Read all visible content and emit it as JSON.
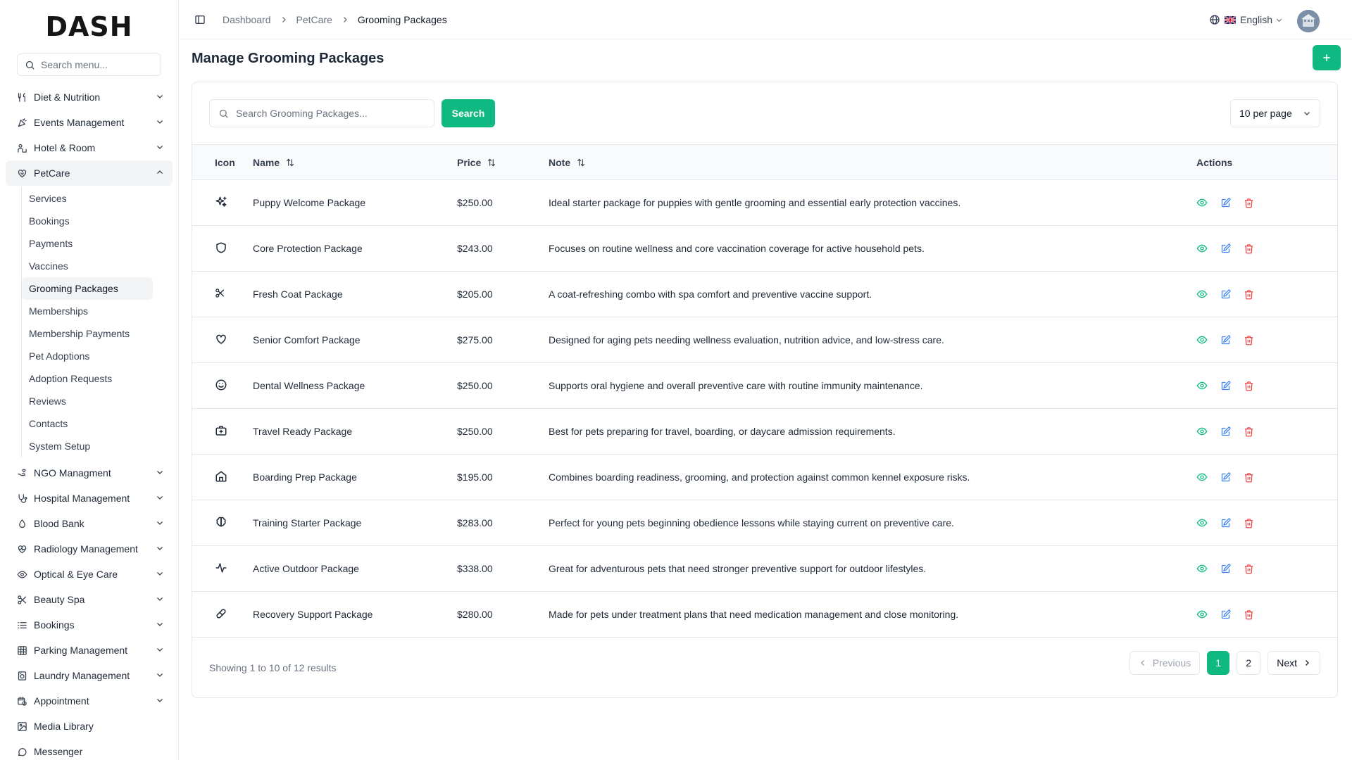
{
  "app": {
    "logo": "DASH",
    "accent": "#10b981"
  },
  "sidebar": {
    "search_placeholder": "Search menu...",
    "items": [
      {
        "label": "Diet & Nutrition",
        "icon": "utensils-icon"
      },
      {
        "label": "Events Management",
        "icon": "party-icon"
      },
      {
        "label": "Hotel & Room",
        "icon": "hotel-icon"
      },
      {
        "label": "PetCare",
        "icon": "paw-heart-icon",
        "open": true
      },
      {
        "label": "NGO Managment",
        "icon": "hand-heart-icon"
      },
      {
        "label": "Hospital Management",
        "icon": "stethoscope-icon"
      },
      {
        "label": "Blood Bank",
        "icon": "drop-icon"
      },
      {
        "label": "Radiology Management",
        "icon": "heart-pulse-icon"
      },
      {
        "label": "Optical & Eye Care",
        "icon": "eye-icon"
      },
      {
        "label": "Beauty Spa",
        "icon": "scissors-icon"
      },
      {
        "label": "Bookings",
        "icon": "list-icon"
      },
      {
        "label": "Parking Management",
        "icon": "grid-icon"
      },
      {
        "label": "Laundry Management",
        "icon": "washer-icon"
      },
      {
        "label": "Appointment",
        "icon": "calendar-clock-icon"
      },
      {
        "label": "Media Library",
        "icon": "image-icon"
      },
      {
        "label": "Messenger",
        "icon": "chat-icon"
      }
    ],
    "petcare_sub": [
      "Services",
      "Bookings",
      "Payments",
      "Vaccines",
      "Grooming Packages",
      "Memberships",
      "Membership Payments",
      "Pet Adoptions",
      "Adoption Requests",
      "Reviews",
      "Contacts",
      "System Setup"
    ]
  },
  "topbar": {
    "breadcrumb": [
      "Dashboard",
      "PetCare",
      "Grooming Packages"
    ],
    "language": "English"
  },
  "page": {
    "title": "Manage Grooming Packages",
    "search_placeholder": "Search Grooming Packages...",
    "search_button": "Search",
    "per_page": "10 per page"
  },
  "table": {
    "headers": {
      "icon": "Icon",
      "name": "Name",
      "price": "Price",
      "note": "Note",
      "actions": "Actions"
    },
    "rows": [
      {
        "icon": "sparkles-icon",
        "name": "Puppy Welcome Package",
        "price": "$250.00",
        "note": "Ideal starter package for puppies with gentle grooming and essential early protection vaccines."
      },
      {
        "icon": "shield-icon",
        "name": "Core Protection Package",
        "price": "$243.00",
        "note": "Focuses on routine wellness and core vaccination coverage for active household pets."
      },
      {
        "icon": "scissors-icon",
        "name": "Fresh Coat Package",
        "price": "$205.00",
        "note": "A coat-refreshing combo with spa comfort and preventive vaccine support."
      },
      {
        "icon": "heart-icon",
        "name": "Senior Comfort Package",
        "price": "$275.00",
        "note": "Designed for aging pets needing wellness evaluation, nutrition advice, and low-stress care."
      },
      {
        "icon": "smile-icon",
        "name": "Dental Wellness Package",
        "price": "$250.00",
        "note": "Supports oral hygiene and overall preventive care with routine immunity maintenance."
      },
      {
        "icon": "medical-bag-icon",
        "name": "Travel Ready Package",
        "price": "$250.00",
        "note": "Best for pets preparing for travel, boarding, or daycare admission requirements."
      },
      {
        "icon": "home-icon",
        "name": "Boarding Prep Package",
        "price": "$195.00",
        "note": "Combines boarding readiness, grooming, and protection against common kennel exposure risks."
      },
      {
        "icon": "brain-icon",
        "name": "Training Starter Package",
        "price": "$283.00",
        "note": "Perfect for young pets beginning obedience lessons while staying current on preventive care."
      },
      {
        "icon": "activity-icon",
        "name": "Active Outdoor Package",
        "price": "$338.00",
        "note": "Great for adventurous pets that need stronger preventive support for outdoor lifestyles."
      },
      {
        "icon": "pill-icon",
        "name": "Recovery Support Package",
        "price": "$280.00",
        "note": "Made for pets under treatment plans that need medication management and close monitoring."
      }
    ]
  },
  "footer": {
    "showing": "Showing 1 to 10 of 12 results",
    "previous": "Previous",
    "next": "Next",
    "pages": [
      "1",
      "2"
    ],
    "current_page": "1"
  }
}
